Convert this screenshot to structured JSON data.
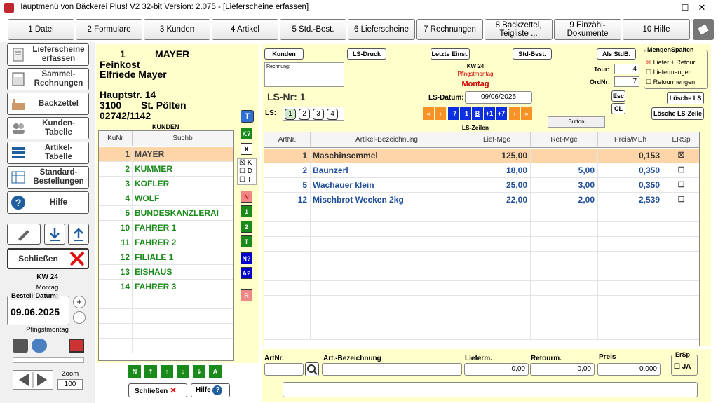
{
  "window": {
    "title": "Hauptmenü von Bäckerei Plus! V2 32-bit Version: 2.075 - [Lieferscheine erfassen]",
    "min": "—",
    "max": "☐",
    "close": "✕"
  },
  "menu": [
    {
      "label": "1 Datei"
    },
    {
      "label": "2 Formulare"
    },
    {
      "label": "3 Kunden"
    },
    {
      "label": "4 Artikel"
    },
    {
      "label": "5 Std.-Best."
    },
    {
      "label": "6 Lieferscheine"
    },
    {
      "label": "7 Rechnungen"
    },
    {
      "label": "8 Backzettel,\nTeigliste ..."
    },
    {
      "label": "9 Einzähl-\nDokumente"
    },
    {
      "label": "10 Hilfe"
    }
  ],
  "sidebar": {
    "items": [
      {
        "label": "Lieferscheine\nerfassen"
      },
      {
        "label": "Sammel-\nRechnungen"
      },
      {
        "label": "Backzettel"
      },
      {
        "label": "Kunden-\nTabelle"
      },
      {
        "label": "Artikel-\nTabelle"
      },
      {
        "label": "Standard-\nBestellungen"
      },
      {
        "label": "Hilfe"
      }
    ],
    "close_label": "Schließen",
    "kw": "KW 24",
    "weekday": "Montag",
    "bestell_label": "Bestell-Datum:",
    "bestell_date": "09.06.2025",
    "holiday": "Pfingstmontag",
    "zoom_label": "Zoom",
    "zoom_value": "100"
  },
  "customer": {
    "nr": "1",
    "name": "MAYER",
    "line1": "Feinkost",
    "line2": "Elfriede Mayer",
    "street": "Hauptstr. 14",
    "zip": "3100",
    "city": "St. Pölten",
    "phone": "02742/1142"
  },
  "kunden": {
    "label": "KUNDEN",
    "col_nr": "KuNr",
    "col_such": "Suchb",
    "rows": [
      {
        "nr": "1",
        "name": "MAYER"
      },
      {
        "nr": "2",
        "name": "KUMMER"
      },
      {
        "nr": "3",
        "name": "KOFLER"
      },
      {
        "nr": "4",
        "name": "WOLF"
      },
      {
        "nr": "5",
        "name": "BUNDESKANZLERAI"
      },
      {
        "nr": "10",
        "name": "FAHRER 1"
      },
      {
        "nr": "11",
        "name": "FAHRER 2"
      },
      {
        "nr": "12",
        "name": "FILIALE 1"
      },
      {
        "nr": "13",
        "name": "EISHAUS"
      },
      {
        "nr": "14",
        "name": "FAHRER 3"
      }
    ]
  },
  "vbuttons": {
    "t": "T",
    "k": "K?",
    "x": "X",
    "chk_k": "K",
    "chk_d": "D",
    "chk_t": "T",
    "n": "N",
    "one": "1",
    "two": "2",
    "tt": "T",
    "nq": "N?",
    "aq": "A?",
    "r": "R"
  },
  "bottomleft": {
    "n": "N",
    "a": "A",
    "close": "Schließen",
    "help": "Hilfe"
  },
  "ls": {
    "btn_kunden": "Kunden",
    "btn_druck": "LS-Druck",
    "btn_letzte": "Letzte Einst.",
    "btn_std": "Std-Best.",
    "btn_als": "Als StdB.",
    "rechnung_label": "Rechnung:",
    "kw": "KW 24",
    "holiday": "Pfingstmontag",
    "weekday": "Montag",
    "nr_label": "LS-Nr: 1",
    "datum_label": "LS-Datum:",
    "datum": "09/06/2025",
    "ls_label": "LS:",
    "ls_tabs": [
      "1",
      "2",
      "3",
      "4"
    ],
    "nav": [
      "«",
      "‹",
      "-7",
      "-1",
      "B",
      "+1",
      "+7",
      "›",
      "»"
    ],
    "button": "Button",
    "zeilen": "LS-Zeilen",
    "mengen_title": "MengenSpalten",
    "opt1": "Liefer + Retour",
    "opt2": "Liefermengen",
    "opt3": "Retourmengen",
    "tour_label": "Tour:",
    "tour": "4",
    "ord_label": "OrdNr:",
    "ord": "7",
    "esc": "Esc",
    "cl": "CL",
    "loesche_ls": "Lösche LS",
    "loesche_zeile": "Lösche LS-Zeile",
    "cols": [
      "ArtNr.",
      "Artikel-Bezeichnung",
      "Lief-Mge",
      "Ret-Mge",
      "Preis/MEh",
      "ERSp"
    ],
    "rows": [
      {
        "nr": "1",
        "bez": "Maschinsemmel",
        "lief": "125,00",
        "ret": "",
        "preis": "0,153"
      },
      {
        "nr": "2",
        "bez": "Baunzerl",
        "lief": "18,00",
        "ret": "5,00",
        "preis": "0,350"
      },
      {
        "nr": "5",
        "bez": "Wachauer klein",
        "lief": "25,00",
        "ret": "3,00",
        "preis": "0,350"
      },
      {
        "nr": "12",
        "bez": "Mischbrot Wecken 2kg",
        "lief": "22,00",
        "ret": "2,00",
        "preis": "2,539"
      }
    ]
  },
  "entry": {
    "artnr": "ArtNr.",
    "bez": "Art.-Bezeichnung",
    "lief": "Lieferm.",
    "ret": "Retourm.",
    "preis": "Preis",
    "lief_v": "0,00",
    "ret_v": "0,00",
    "preis_v": "0,000",
    "ersp": "ErSp",
    "ja": "JA"
  }
}
